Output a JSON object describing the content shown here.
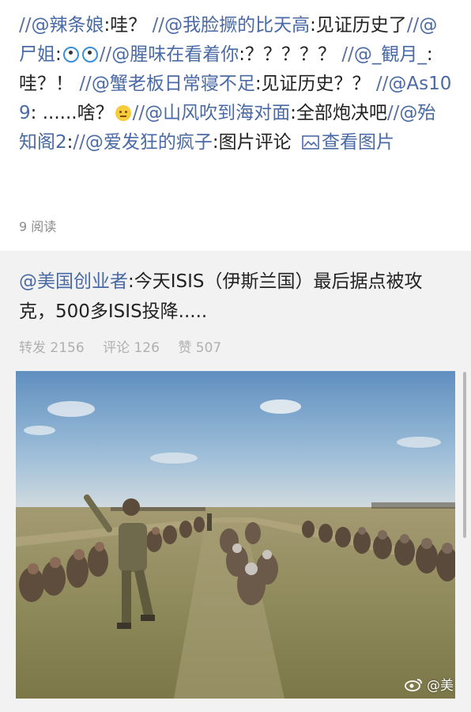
{
  "repost_chain": {
    "segments": [
      {
        "user": "@辣条娘",
        "text": ":哇？"
      },
      {
        "user": "@我脸撅的比天高",
        "text": ":见证历史了"
      },
      {
        "user": "@尸姐",
        "text": ":",
        "emoji": [
          "rolling-eyes",
          "rolling-eyes"
        ]
      },
      {
        "user": "@腥味在看着你",
        "text": ":？？？？？"
      },
      {
        "user": "@_観月_",
        "text": ":哇？！"
      },
      {
        "user": "@蟹老板日常寝不足",
        "text": ":见证历史？？"
      },
      {
        "user": "@As109",
        "text": ": ......啥？",
        "emoji": [
          "thinking"
        ]
      },
      {
        "user": "@山风吹到海对面",
        "text": ":全部炮决吧"
      },
      {
        "user": "@殆知阁2",
        "text": ":"
      },
      {
        "user": "@爱发狂的疯子",
        "text": ":图片评论"
      }
    ],
    "view_picture_label": "查看图片"
  },
  "read_count": "9 阅读",
  "original_post": {
    "author": "@美国创业者",
    "text": ":今天ISIS（伊斯兰国）最后据点被攻克，500多ISIS投降.....",
    "stats": {
      "reposts": "转发 2156",
      "comments": "评论 126",
      "likes": "赞 507"
    },
    "image_watermark": "@美"
  },
  "colors": {
    "link": "#4a6aa6",
    "text": "#222222",
    "muted": "#8c8c8c",
    "card_bg": "#f2f2f2"
  }
}
